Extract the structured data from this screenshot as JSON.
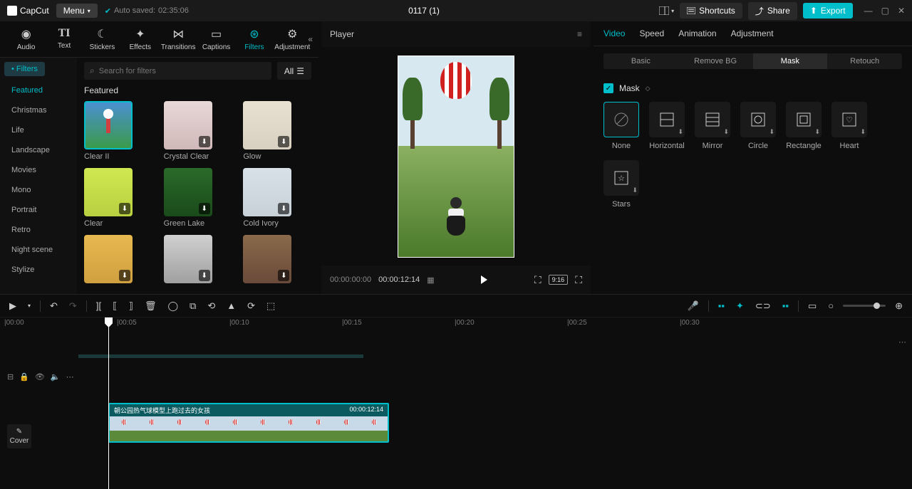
{
  "app": {
    "name": "CapCut"
  },
  "topbar": {
    "menu": "Menu",
    "autosave_prefix": "Auto saved:",
    "autosave_time": "02:35:06",
    "project_title": "0117 (1)",
    "shortcuts": "Shortcuts",
    "share": "Share",
    "export": "Export"
  },
  "media_tabs": [
    {
      "label": "Audio"
    },
    {
      "label": "Text"
    },
    {
      "label": "Stickers"
    },
    {
      "label": "Effects"
    },
    {
      "label": "Transitions"
    },
    {
      "label": "Captions"
    },
    {
      "label": "Filters"
    },
    {
      "label": "Adjustment"
    }
  ],
  "filters": {
    "tag": "Filters",
    "search_placeholder": "Search for filters",
    "all": "All",
    "categories": [
      "Featured",
      "Christmas",
      "Life",
      "Landscape",
      "Movies",
      "Mono",
      "Portrait",
      "Retro",
      "Night scene",
      "Stylize"
    ],
    "section": "Featured",
    "items": [
      {
        "name": "Clear II"
      },
      {
        "name": "Crystal Clear"
      },
      {
        "name": "Glow"
      },
      {
        "name": "Clear"
      },
      {
        "name": "Green Lake"
      },
      {
        "name": "Cold Ivory"
      },
      {
        "name": ""
      },
      {
        "name": ""
      },
      {
        "name": ""
      }
    ]
  },
  "player": {
    "title": "Player",
    "time_current": "00:00:00:00",
    "time_total": "00:00:12:14",
    "ratio": "9:16"
  },
  "right": {
    "tabs": [
      "Video",
      "Speed",
      "Animation",
      "Adjustment"
    ],
    "subtabs": [
      "Basic",
      "Remove BG",
      "Mask",
      "Retouch"
    ],
    "mask_label": "Mask",
    "masks": [
      {
        "name": "None"
      },
      {
        "name": "Horizontal"
      },
      {
        "name": "Mirror"
      },
      {
        "name": "Circle"
      },
      {
        "name": "Rectangle"
      },
      {
        "name": "Heart"
      },
      {
        "name": "Stars"
      }
    ]
  },
  "timeline": {
    "marks": [
      "00:00",
      "00:05",
      "00:10",
      "00:15",
      "00:20",
      "00:25",
      "00:30"
    ],
    "cover": "Cover",
    "clip_title": "朝公园热气球模型上跑过去的女孩",
    "clip_duration": "00:00:12:14"
  }
}
